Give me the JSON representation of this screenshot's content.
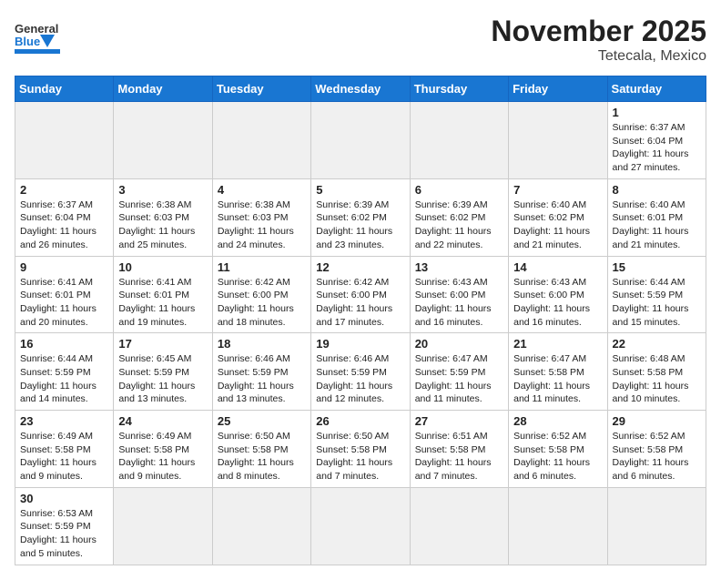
{
  "header": {
    "logo_general": "General",
    "logo_blue": "Blue",
    "title": "November 2025",
    "subtitle": "Tetecala, Mexico"
  },
  "days_of_week": [
    "Sunday",
    "Monday",
    "Tuesday",
    "Wednesday",
    "Thursday",
    "Friday",
    "Saturday"
  ],
  "weeks": [
    [
      {
        "day": "",
        "info": ""
      },
      {
        "day": "",
        "info": ""
      },
      {
        "day": "",
        "info": ""
      },
      {
        "day": "",
        "info": ""
      },
      {
        "day": "",
        "info": ""
      },
      {
        "day": "",
        "info": ""
      },
      {
        "day": "1",
        "info": "Sunrise: 6:37 AM\nSunset: 6:04 PM\nDaylight: 11 hours\nand 27 minutes."
      }
    ],
    [
      {
        "day": "2",
        "info": "Sunrise: 6:37 AM\nSunset: 6:04 PM\nDaylight: 11 hours\nand 26 minutes."
      },
      {
        "day": "3",
        "info": "Sunrise: 6:38 AM\nSunset: 6:03 PM\nDaylight: 11 hours\nand 25 minutes."
      },
      {
        "day": "4",
        "info": "Sunrise: 6:38 AM\nSunset: 6:03 PM\nDaylight: 11 hours\nand 24 minutes."
      },
      {
        "day": "5",
        "info": "Sunrise: 6:39 AM\nSunset: 6:02 PM\nDaylight: 11 hours\nand 23 minutes."
      },
      {
        "day": "6",
        "info": "Sunrise: 6:39 AM\nSunset: 6:02 PM\nDaylight: 11 hours\nand 22 minutes."
      },
      {
        "day": "7",
        "info": "Sunrise: 6:40 AM\nSunset: 6:02 PM\nDaylight: 11 hours\nand 21 minutes."
      },
      {
        "day": "8",
        "info": "Sunrise: 6:40 AM\nSunset: 6:01 PM\nDaylight: 11 hours\nand 21 minutes."
      }
    ],
    [
      {
        "day": "9",
        "info": "Sunrise: 6:41 AM\nSunset: 6:01 PM\nDaylight: 11 hours\nand 20 minutes."
      },
      {
        "day": "10",
        "info": "Sunrise: 6:41 AM\nSunset: 6:01 PM\nDaylight: 11 hours\nand 19 minutes."
      },
      {
        "day": "11",
        "info": "Sunrise: 6:42 AM\nSunset: 6:00 PM\nDaylight: 11 hours\nand 18 minutes."
      },
      {
        "day": "12",
        "info": "Sunrise: 6:42 AM\nSunset: 6:00 PM\nDaylight: 11 hours\nand 17 minutes."
      },
      {
        "day": "13",
        "info": "Sunrise: 6:43 AM\nSunset: 6:00 PM\nDaylight: 11 hours\nand 16 minutes."
      },
      {
        "day": "14",
        "info": "Sunrise: 6:43 AM\nSunset: 6:00 PM\nDaylight: 11 hours\nand 16 minutes."
      },
      {
        "day": "15",
        "info": "Sunrise: 6:44 AM\nSunset: 5:59 PM\nDaylight: 11 hours\nand 15 minutes."
      }
    ],
    [
      {
        "day": "16",
        "info": "Sunrise: 6:44 AM\nSunset: 5:59 PM\nDaylight: 11 hours\nand 14 minutes."
      },
      {
        "day": "17",
        "info": "Sunrise: 6:45 AM\nSunset: 5:59 PM\nDaylight: 11 hours\nand 13 minutes."
      },
      {
        "day": "18",
        "info": "Sunrise: 6:46 AM\nSunset: 5:59 PM\nDaylight: 11 hours\nand 13 minutes."
      },
      {
        "day": "19",
        "info": "Sunrise: 6:46 AM\nSunset: 5:59 PM\nDaylight: 11 hours\nand 12 minutes."
      },
      {
        "day": "20",
        "info": "Sunrise: 6:47 AM\nSunset: 5:59 PM\nDaylight: 11 hours\nand 11 minutes."
      },
      {
        "day": "21",
        "info": "Sunrise: 6:47 AM\nSunset: 5:58 PM\nDaylight: 11 hours\nand 11 minutes."
      },
      {
        "day": "22",
        "info": "Sunrise: 6:48 AM\nSunset: 5:58 PM\nDaylight: 11 hours\nand 10 minutes."
      }
    ],
    [
      {
        "day": "23",
        "info": "Sunrise: 6:49 AM\nSunset: 5:58 PM\nDaylight: 11 hours\nand 9 minutes."
      },
      {
        "day": "24",
        "info": "Sunrise: 6:49 AM\nSunset: 5:58 PM\nDaylight: 11 hours\nand 9 minutes."
      },
      {
        "day": "25",
        "info": "Sunrise: 6:50 AM\nSunset: 5:58 PM\nDaylight: 11 hours\nand 8 minutes."
      },
      {
        "day": "26",
        "info": "Sunrise: 6:50 AM\nSunset: 5:58 PM\nDaylight: 11 hours\nand 7 minutes."
      },
      {
        "day": "27",
        "info": "Sunrise: 6:51 AM\nSunset: 5:58 PM\nDaylight: 11 hours\nand 7 minutes."
      },
      {
        "day": "28",
        "info": "Sunrise: 6:52 AM\nSunset: 5:58 PM\nDaylight: 11 hours\nand 6 minutes."
      },
      {
        "day": "29",
        "info": "Sunrise: 6:52 AM\nSunset: 5:58 PM\nDaylight: 11 hours\nand 6 minutes."
      }
    ],
    [
      {
        "day": "30",
        "info": "Sunrise: 6:53 AM\nSunset: 5:59 PM\nDaylight: 11 hours\nand 5 minutes."
      },
      {
        "day": "",
        "info": ""
      },
      {
        "day": "",
        "info": ""
      },
      {
        "day": "",
        "info": ""
      },
      {
        "day": "",
        "info": ""
      },
      {
        "day": "",
        "info": ""
      },
      {
        "day": "",
        "info": ""
      }
    ]
  ]
}
